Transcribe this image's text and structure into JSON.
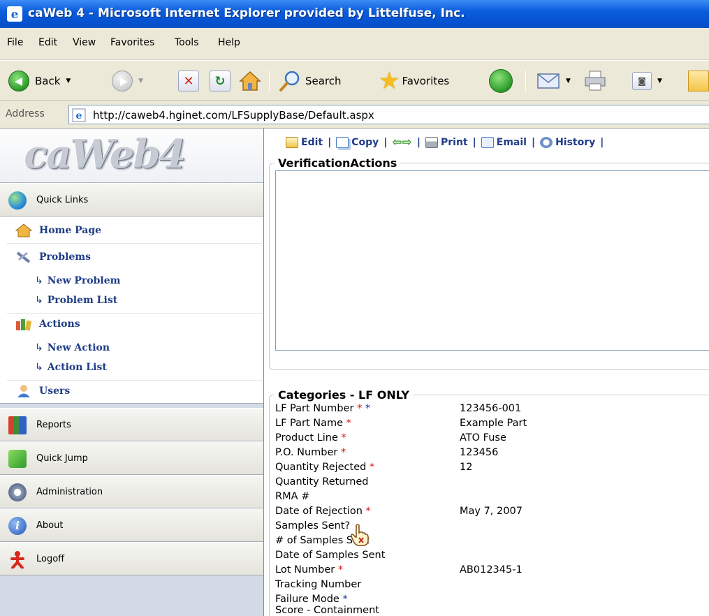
{
  "window": {
    "title": "caWeb 4 - Microsoft Internet Explorer provided by Littelfuse, Inc."
  },
  "menu": [
    "File",
    "Edit",
    "View",
    "Favorites",
    "Tools",
    "Help"
  ],
  "toolbar": {
    "back_label": "Back",
    "search_label": "Search",
    "favorites_label": "Favorites"
  },
  "address": {
    "label": "Address",
    "url": "http://caweb4.hginet.com/LFSupplyBase/Default.aspx"
  },
  "sidebar": {
    "logo_text": "caWeb4",
    "quick_links_label": "Quick Links",
    "links": {
      "home": "Home Page",
      "problems": "Problems",
      "new_problem": "New Problem",
      "problem_list": "Problem List",
      "actions": "Actions",
      "new_action": "New Action",
      "action_list": "Action List",
      "users": "Users"
    },
    "sub_arrow": "↳",
    "panels": {
      "reports": "Reports",
      "quick_jump": "Quick Jump",
      "administration": "Administration",
      "about": "About",
      "logoff": "Logoff"
    }
  },
  "commands": {
    "edit": "Edit",
    "copy": "Copy",
    "print": "Print",
    "email": "Email",
    "history": "History",
    "sep": "|"
  },
  "verification": {
    "legend": "VerificationActions",
    "text": ""
  },
  "categories": {
    "legend": "Categories - LF ONLY",
    "rows": [
      {
        "label": "LF Part Number",
        "req": "*",
        "req2": "*",
        "value": "123456-001"
      },
      {
        "label": "LF Part Name",
        "req": "*",
        "req2": "",
        "value": "Example Part"
      },
      {
        "label": "Product Line",
        "req": "*",
        "req2": "",
        "value": "ATO Fuse"
      },
      {
        "label": "P.O. Number",
        "req": "*",
        "req2": "",
        "value": "123456"
      },
      {
        "label": "Quantity Rejected",
        "req": "*",
        "req2": "",
        "value": "12"
      },
      {
        "label": "Quantity Returned",
        "req": "",
        "req2": "",
        "value": ""
      },
      {
        "label": "RMA #",
        "req": "",
        "req2": "",
        "value": ""
      },
      {
        "label": "Date of Rejection",
        "req": "*",
        "req2": "",
        "value": "May 7, 2007"
      },
      {
        "label": "Samples Sent?",
        "req": "",
        "req2": "",
        "value": ""
      },
      {
        "label": "# of Samples Sent",
        "req": "",
        "req2": "",
        "value": ""
      },
      {
        "label": "Date of Samples Sent",
        "req": "",
        "req2": "",
        "value": ""
      },
      {
        "label": "Lot Number",
        "req": "*",
        "req2": "",
        "value": "AB012345-1"
      },
      {
        "label": "Tracking Number",
        "req": "",
        "req2": "",
        "value": ""
      },
      {
        "label": "Failure Mode",
        "req": "",
        "req2": "*",
        "value": ""
      },
      {
        "label": "Score - Containment",
        "req": "",
        "req2": "",
        "value": ""
      }
    ]
  }
}
